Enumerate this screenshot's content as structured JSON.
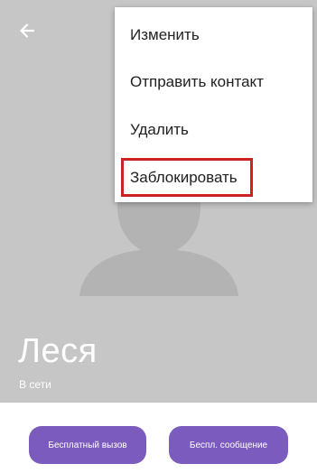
{
  "contact": {
    "name": "Леся",
    "status": "В сети"
  },
  "menu": {
    "items": [
      {
        "label": "Изменить"
      },
      {
        "label": "Отправить контакт"
      },
      {
        "label": "Удалить"
      },
      {
        "label": "Заблокировать",
        "highlighted": true
      }
    ]
  },
  "actions": {
    "free_call_label": "Бесплатный вызов",
    "free_message_label": "Беспл. сообщение"
  },
  "icons": {
    "back": "arrow-left-icon"
  },
  "colors": {
    "header_bg": "#c6c6c6",
    "silhouette": "#b3b3b3",
    "button_bg": "#7b5cbe",
    "highlight_border": "#cc2222"
  }
}
